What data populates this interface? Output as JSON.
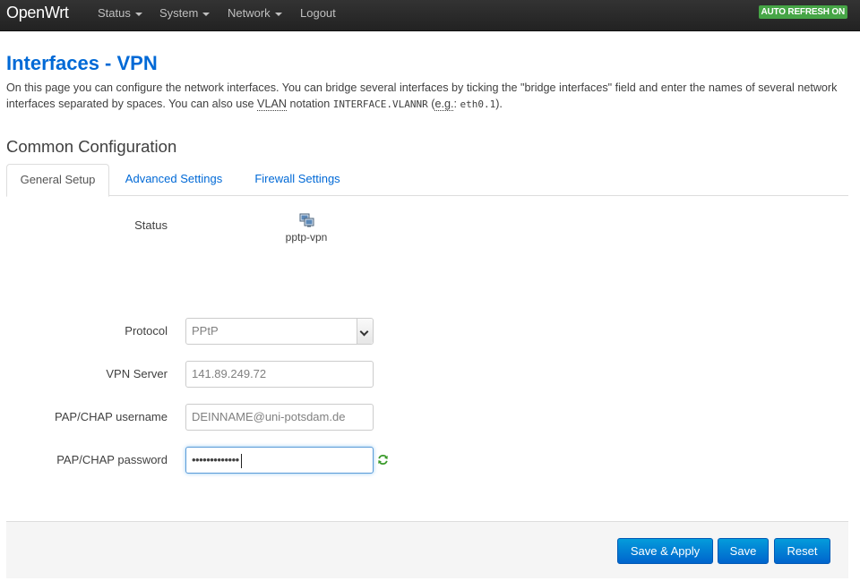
{
  "navbar": {
    "brand": "OpenWrt",
    "items": [
      {
        "label": "Status"
      },
      {
        "label": "System"
      },
      {
        "label": "Network"
      },
      {
        "label": "Logout"
      }
    ],
    "refresh_badge": "AUTO REFRESH ON"
  },
  "page": {
    "title": "Interfaces - VPN",
    "desc_part1": "On this page you can configure the network interfaces. You can bridge several interfaces by ticking the \"bridge interfaces\" field and enter the names of several network interfaces separated by spaces. You can also use ",
    "desc_abbr1": "VLAN",
    "desc_part2": " notation ",
    "desc_code1": "INTERFACE.VLANNR",
    "desc_part3": " (",
    "desc_abbr2": "e.g.",
    "desc_part4": ": ",
    "desc_code2": "eth0.1",
    "desc_part5": ")."
  },
  "section": {
    "title": "Common Configuration",
    "tabs": [
      {
        "label": "General Setup"
      },
      {
        "label": "Advanced Settings"
      },
      {
        "label": "Firewall Settings"
      }
    ]
  },
  "form": {
    "status_label": "Status",
    "status_icon": "network-interface-icon",
    "status_name": "pptp-vpn",
    "protocol_label": "Protocol",
    "protocol_value": "PPtP",
    "server_label": "VPN Server",
    "server_value": "141.89.249.72",
    "username_label": "PAP/CHAP username",
    "username_value": "DEINNAME@uni-potsdam.de",
    "password_label": "PAP/CHAP password",
    "password_masked": "•••••••••••••",
    "reveal_icon": "refresh-reveal-icon"
  },
  "actions": {
    "save_apply": "Save & Apply",
    "save": "Save",
    "reset": "Reset"
  },
  "colors": {
    "accent": "#0069d6",
    "navbar": "#222222",
    "badge": "#46a546",
    "button": "#0064cd"
  }
}
